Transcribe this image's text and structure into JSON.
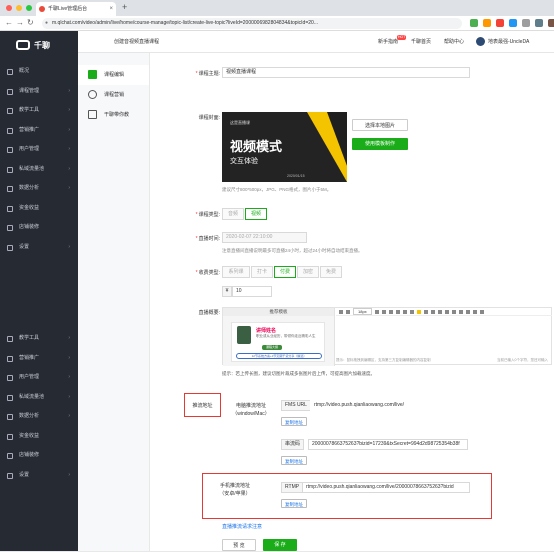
{
  "browser": {
    "tab_title": "千聊Live管理后台",
    "url": "m.qlchat.com/video/admin/live/home/course-manage/topic-list/create-live-topic?liveId=2000006982804834&topicId=20..."
  },
  "sidebar": {
    "logo_text": "千聊",
    "items": [
      {
        "label": "概况",
        "chevron": ""
      },
      {
        "label": "课程管理",
        "chevron": "›"
      },
      {
        "label": "教学工具",
        "chevron": "›"
      },
      {
        "label": "营销推广",
        "chevron": "›"
      },
      {
        "label": "用户管理",
        "chevron": "›"
      },
      {
        "label": "私域流量池",
        "chevron": "›"
      },
      {
        "label": "数据分析",
        "chevron": "›"
      },
      {
        "label": "资金收益",
        "chevron": ""
      },
      {
        "label": "店铺装修",
        "chevron": ""
      },
      {
        "label": "设置",
        "chevron": "›"
      }
    ],
    "items_lower": [
      {
        "label": "教学工具",
        "chevron": "›"
      },
      {
        "label": "营销推广",
        "chevron": "›"
      },
      {
        "label": "用户管理",
        "chevron": "›"
      },
      {
        "label": "私域流量池",
        "chevron": "›"
      },
      {
        "label": "数据分析",
        "chevron": "›"
      },
      {
        "label": "资金收益",
        "chevron": ""
      },
      {
        "label": "店铺装修",
        "chevron": ""
      },
      {
        "label": "设置",
        "chevron": "›"
      }
    ]
  },
  "topbar": {
    "breadcrumb": "创建音视频直播课程",
    "guide": "新手指南",
    "hot": "HOT",
    "home": "千聊首页",
    "help": "帮助中心",
    "user": "地表最强-UncleDA"
  },
  "subnav": [
    {
      "label": "课程编辑",
      "active": true
    },
    {
      "label": "课程营销",
      "active": false
    },
    {
      "label": "干聊带你教",
      "active": false
    }
  ],
  "form": {
    "title_label": "课程主题:",
    "title_value": "视频直播课程",
    "cover_label": "课程封面:",
    "cover": {
      "tag": "这是直播课",
      "line1": "视频模式",
      "line2": "交互体验",
      "date": "2020/01/15"
    },
    "upload_button": "选择本地图片",
    "make_button": "使用模板制作",
    "cover_hint": "建议尺寸800*500px，JPG、PNG格式，图片小于5M。",
    "type_label": "课程类型:",
    "type_options": [
      {
        "label": "音频",
        "on": false
      },
      {
        "label": "视频",
        "on": true
      }
    ],
    "time_label": "直播时间:",
    "time_value": "2020-02-07 22:10:00",
    "time_hint": "注意直播间直播说明最多可直播24小时，超过24小时将自动结束直播。",
    "fee_label": "收费类型:",
    "fee_options": [
      {
        "label": "系列课",
        "on": false
      },
      {
        "label": "打卡",
        "on": false
      },
      {
        "label": "付费",
        "on": true
      },
      {
        "label": "加密",
        "on": false
      },
      {
        "label": "免费",
        "on": false
      }
    ],
    "price_currency": "¥",
    "price_value": "10",
    "intro_label": "直播概要:",
    "template_header": "推荐模板",
    "template_name": "讲师姓名",
    "template_desc": "职业或从业经历，带领你走近精彩人生",
    "template_badge": "课程大纲",
    "template_line": "12节系统方案+3节定期干货分享（精选）",
    "toolbar_font": "18px",
    "editor_footer": "提示：鼠标拖拽到编辑区，支持第三方复制编辑器的内容复制",
    "editor_footer_right": "当前已输入0个字符，您还可输入",
    "intro_hint": "提示：若上传长图，建议切图片裁成多张图片后上传，可提高图片加载速度。",
    "push_label": "推流地址",
    "pc_label_1": "电脑推流地址",
    "pc_label_2": "（window/Mac）",
    "fms_tag": "FMS URL",
    "fms_value": "rtmp://video.push.qianliaowang.com/live/",
    "copy_label": "复制地址",
    "key_tag": "串流码",
    "key_value": "2000007866375263?bizid=17239&txSecret=994d2d98725354b38f",
    "mobile_label_1": "手机推流地址",
    "mobile_label_2": "（安卓/苹果）",
    "rtmp_tag": "RTMP",
    "rtmp_value": "rtmp://video.push.qianliaowang.com/live/2000007866375263?bizid",
    "push_notes_link": "直播推流请求注意",
    "preview_button": "预 览",
    "save_button": "保 存"
  }
}
